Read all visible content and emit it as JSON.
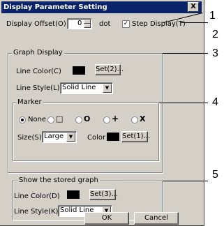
{
  "dialog": {
    "title": "Display Parameter Setting",
    "close_label": "X"
  },
  "display_offset": {
    "label": "Display Offset(O)",
    "value": "0",
    "unit": "dot"
  },
  "step_display": {
    "label": "Step Display(T)",
    "checked": true
  },
  "graph_display": {
    "title": "Graph Display",
    "line_color_label": "Line Color(C)",
    "line_color": "#000000",
    "set_button": "Set(2)...",
    "line_style_label": "Line Style(L)",
    "line_style_value": "Solid Line"
  },
  "marker": {
    "title": "Marker",
    "options": [
      "None",
      "□",
      "O",
      "+",
      "X"
    ],
    "selected": "None",
    "size_label": "Size(S)",
    "size_value": "Large",
    "color_label": "Color",
    "color": "#000000",
    "set_button": "Set(1)..."
  },
  "stored_graph": {
    "title": "Show the stored graph",
    "line_color_label": "Line Color(D)",
    "line_color": "#000000",
    "set_button": "Set(3)...",
    "line_style_label": "Line Style(K)",
    "line_style_value": "Solid Line"
  },
  "buttons": {
    "ok": "OK",
    "cancel": "Cancel"
  },
  "callouts": [
    "1",
    "2",
    "3",
    "4",
    "5"
  ]
}
